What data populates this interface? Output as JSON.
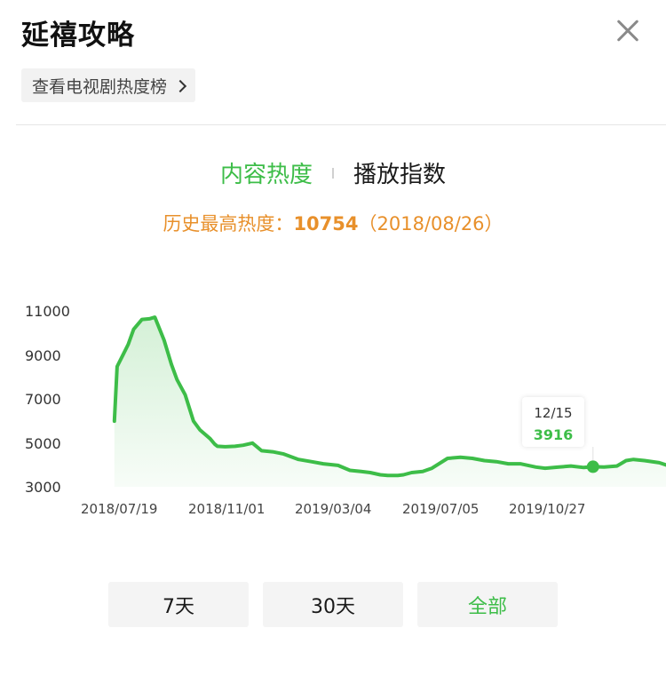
{
  "header": {
    "title": "延禧攻略",
    "rank_link_label": "查看电视剧热度榜"
  },
  "tabs": [
    {
      "label": "内容热度",
      "active": true
    },
    {
      "label": "播放指数",
      "active": false
    }
  ],
  "peak": {
    "label": "历史最高热度：",
    "value": "10754",
    "date": "（2018/08/26）"
  },
  "range_buttons": [
    {
      "label": "7天",
      "active": false
    },
    {
      "label": "30天",
      "active": false
    },
    {
      "label": "全部",
      "active": true
    }
  ],
  "colors": {
    "accent_green": "#3dbd48",
    "peak_orange": "#e8902b"
  },
  "chart_data": {
    "type": "area",
    "y_ticks": [
      "11000",
      "9000",
      "7000",
      "5000",
      "3000"
    ],
    "ylim": [
      3000,
      11000
    ],
    "x_ticks": [
      "2018/07/19",
      "2018/11/01",
      "2019/03/04",
      "2019/07/05",
      "2019/10/27"
    ],
    "tooltip": {
      "date": "12/15",
      "value": "3916"
    },
    "series": [
      {
        "x": [
          "2018/07/13",
          "2018/07/16",
          "2018/07/22",
          "2018/07/28",
          "2018/08/03",
          "2018/08/12",
          "2018/08/20",
          "2018/08/26",
          "2018/09/05",
          "2018/09/13",
          "2018/09/19",
          "2018/09/28",
          "2018/10/07",
          "2018/10/14",
          "2018/10/25",
          "2018/10/30",
          "2018/11/02",
          "2018/11/10",
          "2018/11/21",
          "2018/11/30",
          "2018/12/10",
          "2018/12/20",
          "2019/01/01",
          "2019/01/13",
          "2019/01/29",
          "2019/02/12",
          "2019/02/25",
          "2019/03/13",
          "2019/03/26",
          "2019/04/07",
          "2019/04/17",
          "2019/04/28",
          "2019/05/06",
          "2019/05/17",
          "2019/05/23",
          "2019/06/01",
          "2019/06/13",
          "2019/06/23",
          "2019/07/10",
          "2019/07/24",
          "2019/08/06",
          "2019/08/19",
          "2019/09/01",
          "2019/09/14",
          "2019/09/27",
          "2019/10/14",
          "2019/10/24",
          "2019/11/08",
          "2019/11/21",
          "2019/12/05",
          "2019/12/15",
          "2019/12/27",
          "2020/01/10",
          "2020/01/20",
          "2020/01/28",
          "2020/02/09",
          "2020/02/25",
          "2020/03/07",
          "2020/03/14"
        ],
        "values": [
          6000,
          8500,
          9000,
          9500,
          10200,
          10650,
          10680,
          10754,
          9700,
          8600,
          7900,
          7200,
          6000,
          5600,
          5200,
          4950,
          4850,
          4830,
          4850,
          4900,
          5000,
          4650,
          4600,
          4500,
          4250,
          4150,
          4050,
          3980,
          3750,
          3700,
          3650,
          3550,
          3520,
          3520,
          3550,
          3650,
          3700,
          3850,
          4300,
          4350,
          4300,
          4200,
          4150,
          4050,
          4050,
          3900,
          3850,
          3900,
          3950,
          3880,
          3916,
          3900,
          3950,
          4200,
          4250,
          4200,
          4100,
          3950,
          3930
        ]
      }
    ]
  }
}
